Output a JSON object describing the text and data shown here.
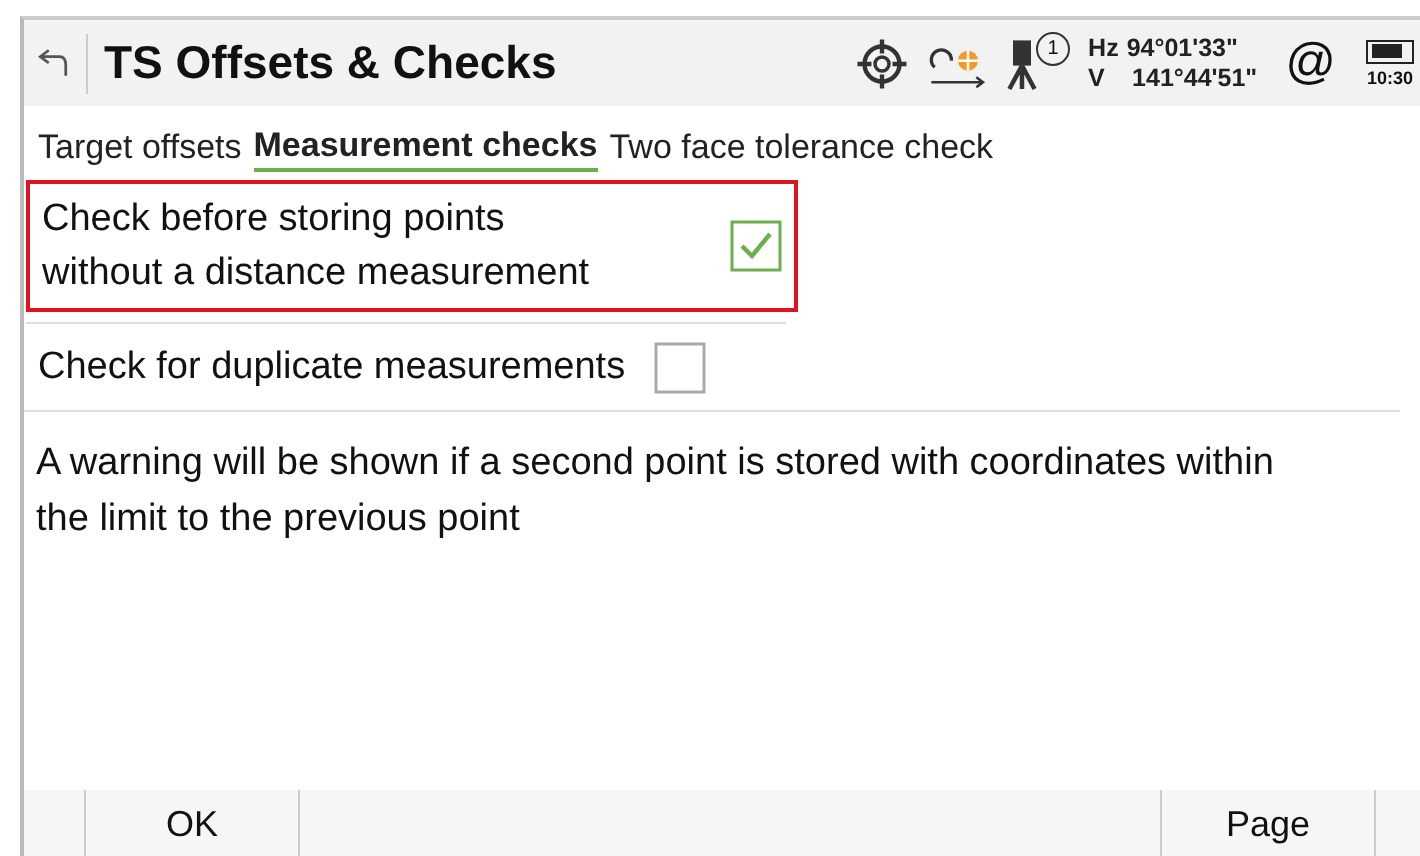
{
  "window": {
    "title": "TS Offsets & Checks"
  },
  "status": {
    "instrument_badge": "1",
    "hz_label": "Hz",
    "hz_value": "94°01'33\"",
    "v_label": "V",
    "v_value": "141°44'51\"",
    "at_symbol": "@",
    "time": "10:30"
  },
  "tabs": [
    {
      "label": "Target offsets",
      "selected": false
    },
    {
      "label": "Measurement checks",
      "selected": true
    },
    {
      "label": "Two face tolerance check",
      "selected": false
    }
  ],
  "options": [
    {
      "label": "Check before storing points\nwithout a distance measurement",
      "checked": true,
      "focused": true
    },
    {
      "label": "Check for duplicate measurements",
      "checked": false,
      "focused": false
    }
  ],
  "info": "A warning will be shown if a second point is stored with coordinates within the limit to the previous point",
  "buttons": [
    {
      "label": "OK"
    },
    {
      "label": "Page"
    }
  ]
}
